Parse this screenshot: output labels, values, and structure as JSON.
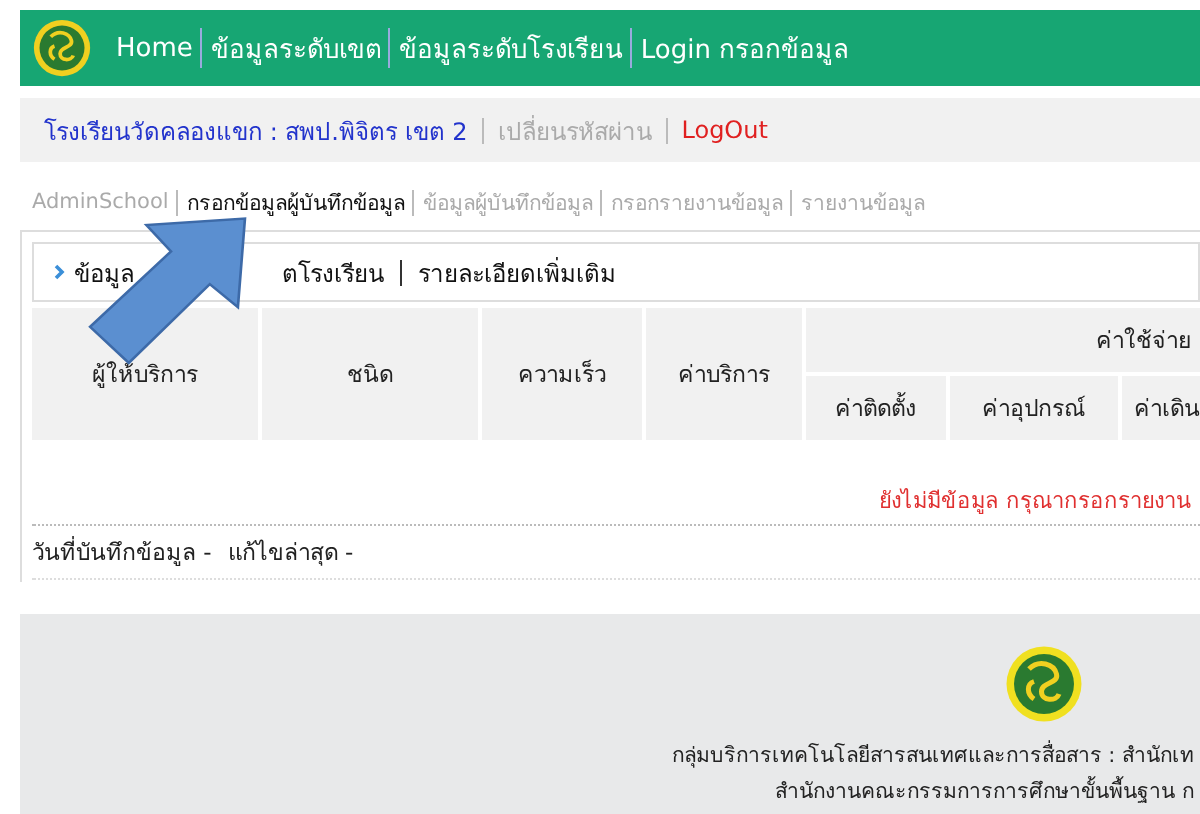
{
  "nav": {
    "items": [
      "Home",
      "ข้อมูลระดับเขต",
      "ข้อมูลระดับโรงเรียน",
      "Login กรอกข้อมูล"
    ]
  },
  "user_bar": {
    "school": "โรงเรียนวัดคลองแขก : สพป.พิจิตร เขต 2",
    "change_password": "เปลี่ยนรหัสผ่าน",
    "logout": "LogOut"
  },
  "tabs": [
    {
      "label": "AdminSchool",
      "selected": false
    },
    {
      "label": "กรอกข้อมูลผู้บันทึกข้อมูล",
      "selected": true
    },
    {
      "label": "ข้อมูลผู้บันทึกข้อมูล",
      "selected": false
    },
    {
      "label": "กรอกรายงานข้อมูล",
      "selected": false
    },
    {
      "label": "รายงานข้อมูล",
      "selected": false
    }
  ],
  "panel": {
    "title_start": "ข้อมูล",
    "title_end": "ตโรงเรียน",
    "more_link": "รายละเอียดเพิ่มเติม"
  },
  "table": {
    "columns": [
      "ผู้ให้บริการ",
      "ชนิด",
      "ความเร็ว",
      "ค่าบริการ"
    ],
    "group": "ค่าใช้จ่าย",
    "subcolumns": [
      "ค่าติดตั้ง",
      "ค่าอุปกรณ์",
      "ค่าเดิน"
    ]
  },
  "empty_message": "ยังไม่มีข้อมูล กรุณากรอกรายงาน",
  "record_info": {
    "saved": "วันที่บันทึกข้อมูล -",
    "edited": "แก้ไขล่าสุด -"
  },
  "footer": {
    "lines": [
      "กลุ่มบริการเทคโนโลยีสารสนเทศและการสื่อสาร : สำนักเท",
      "สำนักงานคณะกรรมการการศึกษาขั้นพื้นฐาน ก"
    ]
  }
}
